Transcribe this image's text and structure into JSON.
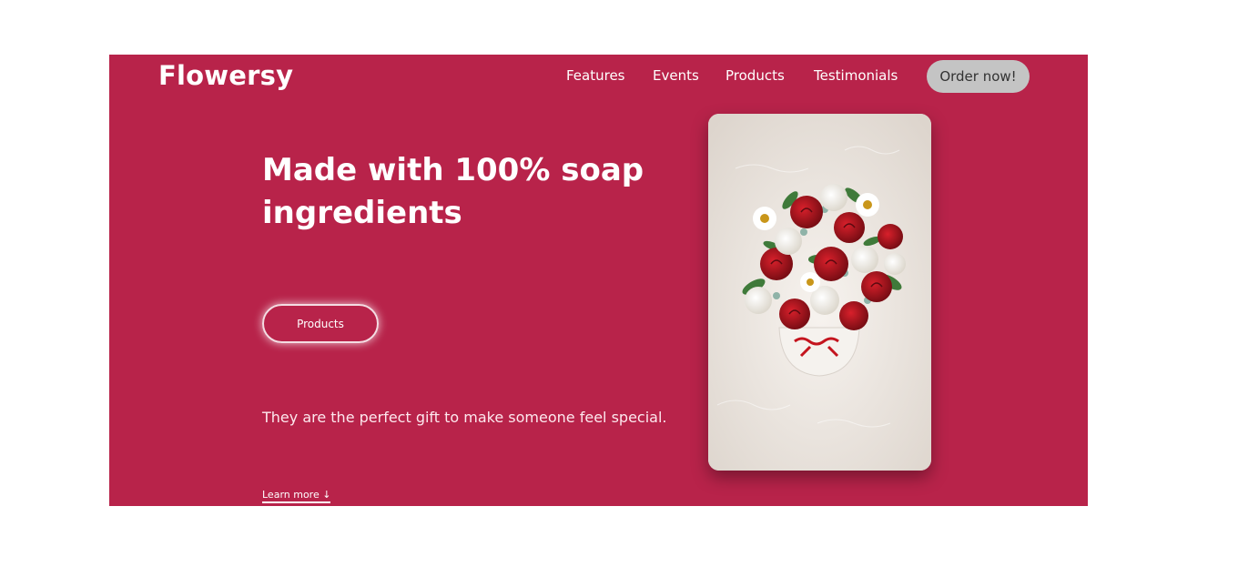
{
  "brand": {
    "name": "Flowersy"
  },
  "nav": {
    "items": [
      {
        "label": "Features"
      },
      {
        "label": "Events"
      },
      {
        "label": "Products"
      },
      {
        "label": "Testimonials"
      }
    ],
    "cta_label": "Order now!"
  },
  "hero": {
    "headline": "Made with 100% soap ingredients",
    "button_label": "Products",
    "tagline": "They are the perfect gift to make someone feel special.",
    "learn_more": "Learn more ↓"
  },
  "colors": {
    "hero_bg": "#b8234a",
    "cta_bg": "#c4c4c4",
    "text": "#ffffff"
  }
}
